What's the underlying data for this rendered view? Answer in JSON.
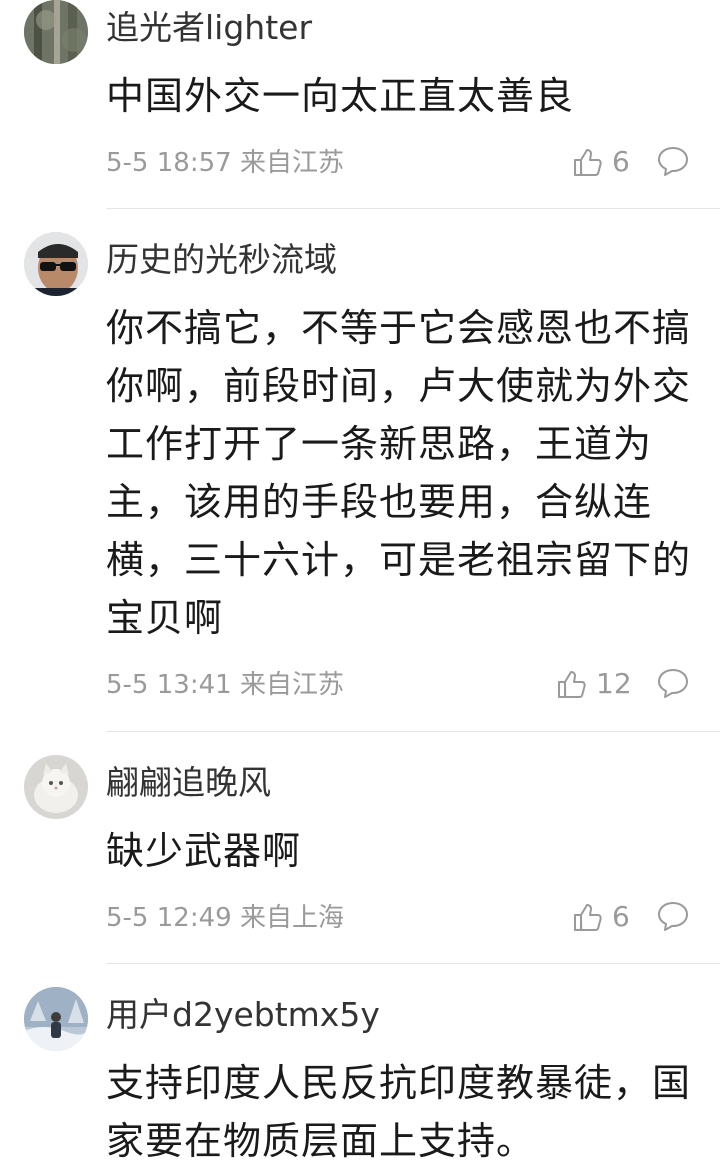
{
  "comments": [
    {
      "username": "追光者lighter",
      "text": "中国外交一向太正直太善良",
      "date": "5-5 18:57",
      "location": "来自江苏",
      "likes": "6",
      "avatar_icon": "forest-tree-avatar"
    },
    {
      "username": "历史的光秒流域",
      "text": "你不搞它，不等于它会感恩也不搞你啊，前段时间，卢大使就为外交工作打开了一条新思路，王道为主，该用的手段也要用，合纵连横，三十六计，可是老祖宗留下的宝贝啊",
      "date": "5-5 13:41",
      "location": "来自江苏",
      "likes": "12",
      "avatar_icon": "sunglasses-man-avatar"
    },
    {
      "username": "翩翩追晚风",
      "text": "缺少武器啊",
      "date": "5-5 12:49",
      "location": "来自上海",
      "likes": "6",
      "avatar_icon": "white-cat-avatar"
    },
    {
      "username": "用户d2yebtmx5y",
      "text": "支持印度人民反抗印度教暴徒，国家要在物质层面上支持。",
      "avatar_icon": "snow-person-avatar"
    }
  ],
  "colors": {
    "meta_gray": "#9a9a9a",
    "divider": "#e6e6e6",
    "text": "#1a1a1a"
  },
  "icons": {
    "like": "thumbs-up-icon",
    "reply": "comment-bubble-icon"
  }
}
